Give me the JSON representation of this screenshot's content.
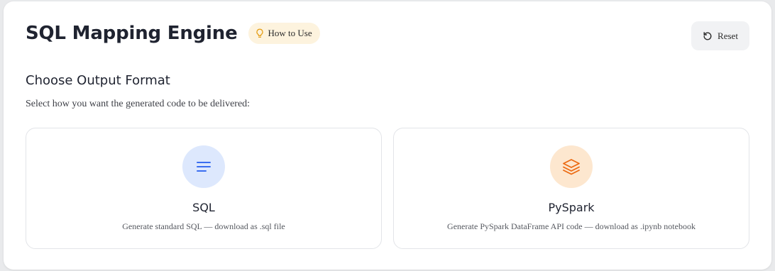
{
  "header": {
    "title": "SQL Mapping Engine",
    "how_to_label": "How to Use",
    "how_to_icon": "lightbulb-icon",
    "reset_label": "Reset",
    "reset_icon": "rotate-ccw-icon"
  },
  "section": {
    "title": "Choose Output Format",
    "description": "Select how you want the generated code to be delivered:"
  },
  "options": [
    {
      "title": "SQL",
      "description": "Generate standard SQL — download as .sql file",
      "icon": "text-lines-icon",
      "icon_color": "#3b6ef0",
      "icon_bg": "#dde8fd"
    },
    {
      "title": "PySpark",
      "description": "Generate PySpark DataFrame API code — download as .ipynb notebook",
      "icon": "layers-icon",
      "icon_color": "#ec6a12",
      "icon_bg": "#fde7cf"
    }
  ],
  "colors": {
    "how_to_bg": "#fdf3de",
    "lightbulb": "#e5a01a",
    "reset_bg": "#f1f2f4"
  }
}
